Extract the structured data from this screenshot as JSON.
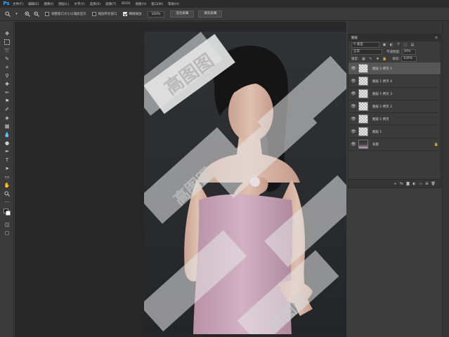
{
  "app": {
    "logo": "Ps"
  },
  "menu": [
    "文件(F)",
    "编辑(E)",
    "图像(I)",
    "图层(L)",
    "文字(Y)",
    "选择(S)",
    "滤镜(T)",
    "3D(D)",
    "视图(V)",
    "窗口(W)",
    "帮助(H)"
  ],
  "options": {
    "resize_windows_label": "调整窗口大小以满屏显示",
    "zoom_all_windows_label": "缩放所有窗口",
    "scrubby_zoom_label": "细微缩放",
    "zoom_value": "100%",
    "fit_screen_button": "适合屏幕",
    "fill_screen_button": "填充屏幕"
  },
  "layers_panel": {
    "tab": "图层",
    "filter_kind": "类型",
    "blend_mode": "正常",
    "opacity_label": "不透明度:",
    "opacity_value": "30%",
    "lock_label": "锁定:",
    "fill_label": "填充:",
    "fill_value": "100%",
    "layers": [
      {
        "name": "图层 1 拷贝 5",
        "active": true,
        "thumb": "transparent"
      },
      {
        "name": "图层 1 拷贝 4",
        "active": false,
        "thumb": "transparent"
      },
      {
        "name": "图层 1 拷贝 3",
        "active": false,
        "thumb": "transparent"
      },
      {
        "name": "图层 1 拷贝 2",
        "active": false,
        "thumb": "transparent"
      },
      {
        "name": "图层 1 拷贝",
        "active": false,
        "thumb": "transparent"
      },
      {
        "name": "图层 1",
        "active": false,
        "thumb": "transparent"
      },
      {
        "name": "背景",
        "active": false,
        "thumb": "photo",
        "locked": true
      }
    ]
  },
  "canvas": {
    "watermark_text": "高图图",
    "photo_background_color": "#2a2b2e",
    "dress_color": "#c7a3b5",
    "watermark_color": "#e8e8e8"
  },
  "colors": {
    "accent": "#31a8ff",
    "chrome": "#3a3a3a",
    "menubar": "#2b2b2b"
  }
}
